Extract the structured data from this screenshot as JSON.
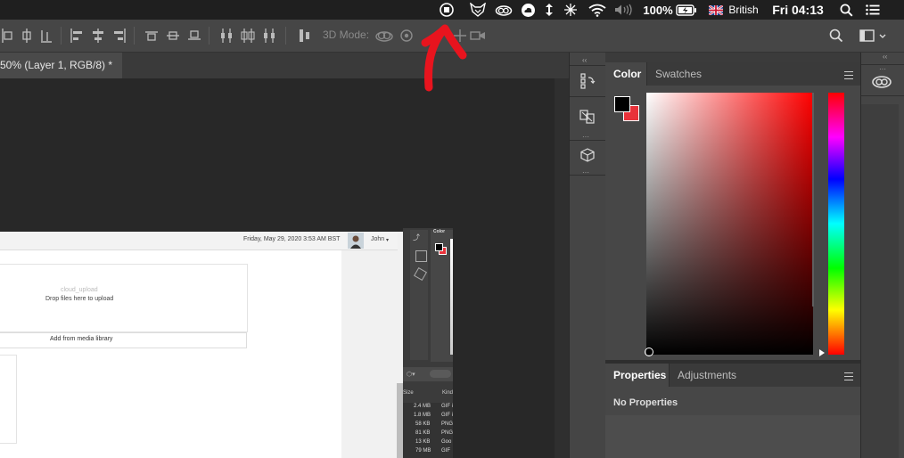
{
  "menubar": {
    "battery": "100%",
    "input_source": "British",
    "clock": "Fri 04:13"
  },
  "optionsbar": {
    "mode_3d_label": "3D Mode:"
  },
  "document": {
    "tab_title": "50% (Layer 1, RGB/8) *"
  },
  "color_panel": {
    "tabs": [
      "Color",
      "Swatches"
    ],
    "foreground": "#000000",
    "background": "#e8323a",
    "hue": "#ff0000"
  },
  "properties_panel": {
    "tabs": [
      "Properties",
      "Adjustments"
    ],
    "empty_text": "No Properties"
  },
  "inner_screenshot": {
    "date_text": "Friday, May 29, 2020 3:53 AM BST",
    "user_name": "John",
    "upload_label": "cloud_upload",
    "drop_text": "Drop files here to upload",
    "media_button": "Add from media library",
    "mini_color_tab": "Color",
    "file_columns": [
      "Size",
      "Kind"
    ],
    "file_rows": [
      {
        "size": "2.4 MB",
        "kind": "GIF i"
      },
      {
        "size": "1.8 MB",
        "kind": "GIF i"
      },
      {
        "size": "58 KB",
        "kind": "PNG"
      },
      {
        "size": "81 KB",
        "kind": "PNG"
      },
      {
        "size": "13 KB",
        "kind": "Goo"
      },
      {
        "size": "79 MB",
        "kind": "GIF"
      }
    ]
  },
  "annotation": {
    "arrow_color": "#e8141e"
  }
}
